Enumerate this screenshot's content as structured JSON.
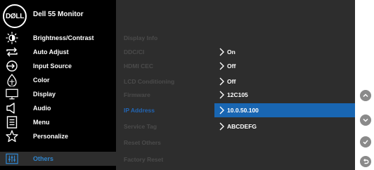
{
  "header": {
    "logo_text": "DØLL",
    "title": "Dell 55 Monitor"
  },
  "colors": {
    "background": "#000000",
    "panel": "#2d2d2d",
    "accent": "#2265b3",
    "active_menu_text": "#2f84cc",
    "inactive_text": "#4b4b4b",
    "nav_button": "#8a8a8a"
  },
  "sidebar": {
    "items": [
      {
        "label": "Brightness/Contrast",
        "icon": "brightness-icon"
      },
      {
        "label": "Auto Adjust",
        "icon": "auto-adjust-icon"
      },
      {
        "label": "Input Source",
        "icon": "input-source-icon"
      },
      {
        "label": "Color",
        "icon": "color-icon"
      },
      {
        "label": "Display",
        "icon": "display-icon"
      },
      {
        "label": "Audio",
        "icon": "audio-icon"
      },
      {
        "label": "Menu",
        "icon": "menu-icon"
      },
      {
        "label": "Personalize",
        "icon": "personalize-icon"
      },
      {
        "label": "Others",
        "icon": "others-icon",
        "selected": true
      }
    ]
  },
  "others": {
    "rows": [
      {
        "label": "Display Info",
        "value": ""
      },
      {
        "label": "DDC/CI",
        "value": "On"
      },
      {
        "label": "HDMI CEC",
        "value": "Off"
      },
      {
        "label": "LCD Conditioning",
        "value": "Off"
      },
      {
        "label": "Firmware",
        "value": "12C105"
      },
      {
        "label": "IP Address",
        "value": "10.0.50.100",
        "selected": true
      },
      {
        "label": "Service Tag",
        "value": "ABCDEFG"
      },
      {
        "label": "Reset Others",
        "value": ""
      },
      {
        "label": "Factory Reset",
        "value": ""
      }
    ]
  },
  "nav_buttons": [
    {
      "icon": "chevron-up-icon"
    },
    {
      "icon": "chevron-down-icon"
    },
    {
      "icon": "check-icon"
    },
    {
      "icon": "back-icon"
    }
  ]
}
